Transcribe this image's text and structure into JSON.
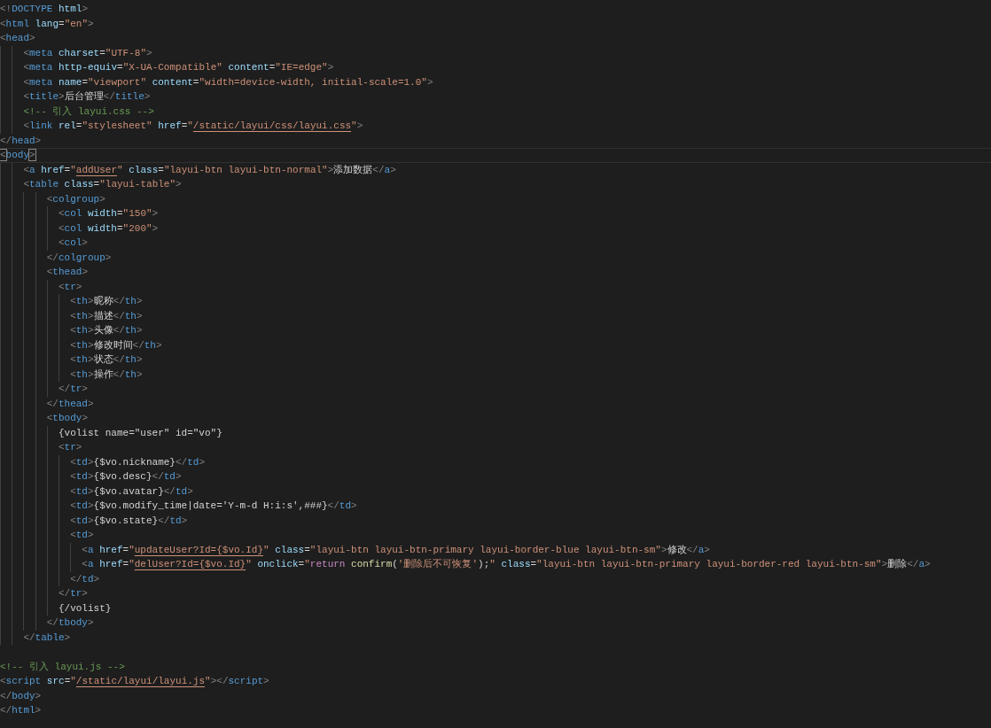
{
  "editor": {
    "lines": [
      {
        "current": false,
        "tokens": [
          {
            "kind": "punct",
            "text": "<!"
          },
          {
            "kind": "tag",
            "text": "DOCTYPE"
          },
          {
            "kind": "attr",
            "text": " html"
          },
          {
            "kind": "punct",
            "text": ">"
          }
        ]
      },
      {
        "current": false,
        "tokens": [
          {
            "kind": "punct",
            "text": "<"
          },
          {
            "kind": "tag",
            "text": "html"
          },
          {
            "kind": "attr",
            "text": " lang"
          },
          {
            "kind": "text",
            "text": "="
          },
          {
            "kind": "string",
            "text": "\"en\""
          },
          {
            "kind": "punct",
            "text": ">"
          }
        ]
      },
      {
        "current": false,
        "tokens": [
          {
            "kind": "punct",
            "text": "<"
          },
          {
            "kind": "tag",
            "text": "head"
          },
          {
            "kind": "punct",
            "text": ">"
          }
        ],
        "children": [
          {
            "current": false,
            "tokens": [
              {
                "kind": "punct",
                "text": "<"
              },
              {
                "kind": "tag",
                "text": "meta"
              },
              {
                "kind": "attr",
                "text": " charset"
              },
              {
                "kind": "text",
                "text": "="
              },
              {
                "kind": "string",
                "text": "\"UTF-8\""
              },
              {
                "kind": "punct",
                "text": ">"
              }
            ]
          },
          {
            "current": false,
            "tokens": [
              {
                "kind": "punct",
                "text": "<"
              },
              {
                "kind": "tag",
                "text": "meta"
              },
              {
                "kind": "attr",
                "text": " http-equiv"
              },
              {
                "kind": "text",
                "text": "="
              },
              {
                "kind": "string",
                "text": "\"X-UA-Compatible\""
              },
              {
                "kind": "attr",
                "text": " content"
              },
              {
                "kind": "text",
                "text": "="
              },
              {
                "kind": "string",
                "text": "\"IE=edge\""
              },
              {
                "kind": "punct",
                "text": ">"
              }
            ]
          },
          {
            "current": false,
            "tokens": [
              {
                "kind": "punct",
                "text": "<"
              },
              {
                "kind": "tag",
                "text": "meta"
              },
              {
                "kind": "attr",
                "text": " name"
              },
              {
                "kind": "text",
                "text": "="
              },
              {
                "kind": "string",
                "text": "\"viewport\""
              },
              {
                "kind": "attr",
                "text": " content"
              },
              {
                "kind": "text",
                "text": "="
              },
              {
                "kind": "string",
                "text": "\"width=device-width, initial-scale=1.0\""
              },
              {
                "kind": "punct",
                "text": ">"
              }
            ]
          },
          {
            "current": false,
            "tokens": [
              {
                "kind": "punct",
                "text": "<"
              },
              {
                "kind": "tag",
                "text": "title"
              },
              {
                "kind": "punct",
                "text": ">"
              },
              {
                "kind": "text",
                "text": "后台管理"
              },
              {
                "kind": "punct",
                "text": "</"
              },
              {
                "kind": "tag",
                "text": "title"
              },
              {
                "kind": "punct",
                "text": ">"
              }
            ]
          },
          {
            "current": false,
            "tokens": [
              {
                "kind": "comment",
                "text": "<!-- 引入 layui.css -->"
              }
            ]
          },
          {
            "current": false,
            "tokens": [
              {
                "kind": "punct",
                "text": "<"
              },
              {
                "kind": "tag",
                "text": "link"
              },
              {
                "kind": "attr",
                "text": " rel"
              },
              {
                "kind": "text",
                "text": "="
              },
              {
                "kind": "string",
                "text": "\"stylesheet\""
              },
              {
                "kind": "attr",
                "text": " href"
              },
              {
                "kind": "text",
                "text": "="
              },
              {
                "kind": "string",
                "text": "\""
              },
              {
                "kind": "link",
                "text": "/static/layui/css/layui.css"
              },
              {
                "kind": "string",
                "text": "\""
              },
              {
                "kind": "punct",
                "text": ">"
              }
            ]
          }
        ]
      },
      {
        "current": false,
        "tokens": [
          {
            "kind": "punct",
            "text": "</"
          },
          {
            "kind": "tag",
            "text": "head"
          },
          {
            "kind": "punct",
            "text": ">"
          }
        ]
      },
      {
        "current": true,
        "tokens": [
          {
            "kind": "match",
            "text": "<"
          },
          {
            "kind": "tag",
            "text": "body"
          },
          {
            "kind": "match",
            "text": ">"
          }
        ],
        "children": [
          {
            "current": false,
            "tokens": [
              {
                "kind": "punct",
                "text": "<"
              },
              {
                "kind": "tag",
                "text": "a"
              },
              {
                "kind": "attr",
                "text": " href"
              },
              {
                "kind": "text",
                "text": "="
              },
              {
                "kind": "string",
                "text": "\""
              },
              {
                "kind": "link",
                "text": "addUser"
              },
              {
                "kind": "string",
                "text": "\""
              },
              {
                "kind": "attr",
                "text": " class"
              },
              {
                "kind": "text",
                "text": "="
              },
              {
                "kind": "string",
                "text": "\"layui-btn layui-btn-normal\""
              },
              {
                "kind": "punct",
                "text": ">"
              },
              {
                "kind": "text",
                "text": "添加数据"
              },
              {
                "kind": "punct",
                "text": "</"
              },
              {
                "kind": "tag",
                "text": "a"
              },
              {
                "kind": "punct",
                "text": ">"
              }
            ]
          },
          {
            "current": false,
            "tokens": [
              {
                "kind": "punct",
                "text": "<"
              },
              {
                "kind": "tag",
                "text": "table"
              },
              {
                "kind": "attr",
                "text": " class"
              },
              {
                "kind": "text",
                "text": "="
              },
              {
                "kind": "string",
                "text": "\"layui-table\""
              },
              {
                "kind": "punct",
                "text": ">"
              }
            ],
            "children": [
              {
                "current": false,
                "tokens": [
                  {
                    "kind": "punct",
                    "text": "<"
                  },
                  {
                    "kind": "tag",
                    "text": "colgroup"
                  },
                  {
                    "kind": "punct",
                    "text": ">"
                  }
                ],
                "children": [
                  {
                    "current": false,
                    "tokens": [
                      {
                        "kind": "punct",
                        "text": "<"
                      },
                      {
                        "kind": "tag",
                        "text": "col"
                      },
                      {
                        "kind": "attr",
                        "text": " width"
                      },
                      {
                        "kind": "text",
                        "text": "="
                      },
                      {
                        "kind": "string",
                        "text": "\"150\""
                      },
                      {
                        "kind": "punct",
                        "text": ">"
                      }
                    ]
                  },
                  {
                    "current": false,
                    "tokens": [
                      {
                        "kind": "punct",
                        "text": "<"
                      },
                      {
                        "kind": "tag",
                        "text": "col"
                      },
                      {
                        "kind": "attr",
                        "text": " width"
                      },
                      {
                        "kind": "text",
                        "text": "="
                      },
                      {
                        "kind": "string",
                        "text": "\"200\""
                      },
                      {
                        "kind": "punct",
                        "text": ">"
                      }
                    ]
                  },
                  {
                    "current": false,
                    "tokens": [
                      {
                        "kind": "punct",
                        "text": "<"
                      },
                      {
                        "kind": "tag",
                        "text": "col"
                      },
                      {
                        "kind": "punct",
                        "text": ">"
                      }
                    ]
                  }
                ]
              },
              {
                "current": false,
                "tokens": [
                  {
                    "kind": "punct",
                    "text": "</"
                  },
                  {
                    "kind": "tag",
                    "text": "colgroup"
                  },
                  {
                    "kind": "punct",
                    "text": ">"
                  }
                ]
              },
              {
                "current": false,
                "tokens": [
                  {
                    "kind": "punct",
                    "text": "<"
                  },
                  {
                    "kind": "tag",
                    "text": "thead"
                  },
                  {
                    "kind": "punct",
                    "text": ">"
                  }
                ],
                "children": [
                  {
                    "current": false,
                    "tokens": [
                      {
                        "kind": "punct",
                        "text": "<"
                      },
                      {
                        "kind": "tag",
                        "text": "tr"
                      },
                      {
                        "kind": "punct",
                        "text": ">"
                      }
                    ],
                    "children": [
                      {
                        "current": false,
                        "tokens": [
                          {
                            "kind": "punct",
                            "text": "<"
                          },
                          {
                            "kind": "tag",
                            "text": "th"
                          },
                          {
                            "kind": "punct",
                            "text": ">"
                          },
                          {
                            "kind": "text",
                            "text": "昵称"
                          },
                          {
                            "kind": "punct",
                            "text": "</"
                          },
                          {
                            "kind": "tag",
                            "text": "th"
                          },
                          {
                            "kind": "punct",
                            "text": ">"
                          }
                        ]
                      },
                      {
                        "current": false,
                        "tokens": [
                          {
                            "kind": "punct",
                            "text": "<"
                          },
                          {
                            "kind": "tag",
                            "text": "th"
                          },
                          {
                            "kind": "punct",
                            "text": ">"
                          },
                          {
                            "kind": "text",
                            "text": "描述"
                          },
                          {
                            "kind": "punct",
                            "text": "</"
                          },
                          {
                            "kind": "tag",
                            "text": "th"
                          },
                          {
                            "kind": "punct",
                            "text": ">"
                          }
                        ]
                      },
                      {
                        "current": false,
                        "tokens": [
                          {
                            "kind": "punct",
                            "text": "<"
                          },
                          {
                            "kind": "tag",
                            "text": "th"
                          },
                          {
                            "kind": "punct",
                            "text": ">"
                          },
                          {
                            "kind": "text",
                            "text": "头像"
                          },
                          {
                            "kind": "punct",
                            "text": "</"
                          },
                          {
                            "kind": "tag",
                            "text": "th"
                          },
                          {
                            "kind": "punct",
                            "text": ">"
                          }
                        ]
                      },
                      {
                        "current": false,
                        "tokens": [
                          {
                            "kind": "punct",
                            "text": "<"
                          },
                          {
                            "kind": "tag",
                            "text": "th"
                          },
                          {
                            "kind": "punct",
                            "text": ">"
                          },
                          {
                            "kind": "text",
                            "text": "修改时间"
                          },
                          {
                            "kind": "punct",
                            "text": "</"
                          },
                          {
                            "kind": "tag",
                            "text": "th"
                          },
                          {
                            "kind": "punct",
                            "text": ">"
                          }
                        ]
                      },
                      {
                        "current": false,
                        "tokens": [
                          {
                            "kind": "punct",
                            "text": "<"
                          },
                          {
                            "kind": "tag",
                            "text": "th"
                          },
                          {
                            "kind": "punct",
                            "text": ">"
                          },
                          {
                            "kind": "text",
                            "text": "状态"
                          },
                          {
                            "kind": "punct",
                            "text": "</"
                          },
                          {
                            "kind": "tag",
                            "text": "th"
                          },
                          {
                            "kind": "punct",
                            "text": ">"
                          }
                        ]
                      },
                      {
                        "current": false,
                        "tokens": [
                          {
                            "kind": "punct",
                            "text": "<"
                          },
                          {
                            "kind": "tag",
                            "text": "th"
                          },
                          {
                            "kind": "punct",
                            "text": ">"
                          },
                          {
                            "kind": "text",
                            "text": "操作"
                          },
                          {
                            "kind": "punct",
                            "text": "</"
                          },
                          {
                            "kind": "tag",
                            "text": "th"
                          },
                          {
                            "kind": "punct",
                            "text": ">"
                          }
                        ]
                      }
                    ]
                  },
                  {
                    "current": false,
                    "tokens": [
                      {
                        "kind": "punct",
                        "text": "</"
                      },
                      {
                        "kind": "tag",
                        "text": "tr"
                      },
                      {
                        "kind": "punct",
                        "text": ">"
                      }
                    ]
                  }
                ]
              },
              {
                "current": false,
                "tokens": [
                  {
                    "kind": "punct",
                    "text": "</"
                  },
                  {
                    "kind": "tag",
                    "text": "thead"
                  },
                  {
                    "kind": "punct",
                    "text": ">"
                  }
                ]
              },
              {
                "current": false,
                "tokens": [
                  {
                    "kind": "punct",
                    "text": "<"
                  },
                  {
                    "kind": "tag",
                    "text": "tbody"
                  },
                  {
                    "kind": "punct",
                    "text": ">"
                  }
                ],
                "children": [
                  {
                    "current": false,
                    "tokens": [
                      {
                        "kind": "text",
                        "text": "{volist name=\"user\" id=\"vo\"}"
                      }
                    ]
                  },
                  {
                    "current": false,
                    "tokens": [
                      {
                        "kind": "punct",
                        "text": "<"
                      },
                      {
                        "kind": "tag",
                        "text": "tr"
                      },
                      {
                        "kind": "punct",
                        "text": ">"
                      }
                    ],
                    "children": [
                      {
                        "current": false,
                        "tokens": [
                          {
                            "kind": "punct",
                            "text": "<"
                          },
                          {
                            "kind": "tag",
                            "text": "td"
                          },
                          {
                            "kind": "punct",
                            "text": ">"
                          },
                          {
                            "kind": "text",
                            "text": "{$vo.nickname}"
                          },
                          {
                            "kind": "punct",
                            "text": "</"
                          },
                          {
                            "kind": "tag",
                            "text": "td"
                          },
                          {
                            "kind": "punct",
                            "text": ">"
                          }
                        ]
                      },
                      {
                        "current": false,
                        "tokens": [
                          {
                            "kind": "punct",
                            "text": "<"
                          },
                          {
                            "kind": "tag",
                            "text": "td"
                          },
                          {
                            "kind": "punct",
                            "text": ">"
                          },
                          {
                            "kind": "text",
                            "text": "{$vo.desc}"
                          },
                          {
                            "kind": "punct",
                            "text": "</"
                          },
                          {
                            "kind": "tag",
                            "text": "td"
                          },
                          {
                            "kind": "punct",
                            "text": ">"
                          }
                        ]
                      },
                      {
                        "current": false,
                        "tokens": [
                          {
                            "kind": "punct",
                            "text": "<"
                          },
                          {
                            "kind": "tag",
                            "text": "td"
                          },
                          {
                            "kind": "punct",
                            "text": ">"
                          },
                          {
                            "kind": "text",
                            "text": "{$vo.avatar}"
                          },
                          {
                            "kind": "punct",
                            "text": "</"
                          },
                          {
                            "kind": "tag",
                            "text": "td"
                          },
                          {
                            "kind": "punct",
                            "text": ">"
                          }
                        ]
                      },
                      {
                        "current": false,
                        "tokens": [
                          {
                            "kind": "punct",
                            "text": "<"
                          },
                          {
                            "kind": "tag",
                            "text": "td"
                          },
                          {
                            "kind": "punct",
                            "text": ">"
                          },
                          {
                            "kind": "text",
                            "text": "{$vo.modify_time|date='Y-m-d H:i:s',###}"
                          },
                          {
                            "kind": "punct",
                            "text": "</"
                          },
                          {
                            "kind": "tag",
                            "text": "td"
                          },
                          {
                            "kind": "punct",
                            "text": ">"
                          }
                        ]
                      },
                      {
                        "current": false,
                        "tokens": [
                          {
                            "kind": "punct",
                            "text": "<"
                          },
                          {
                            "kind": "tag",
                            "text": "td"
                          },
                          {
                            "kind": "punct",
                            "text": ">"
                          },
                          {
                            "kind": "text",
                            "text": "{$vo.state}"
                          },
                          {
                            "kind": "punct",
                            "text": "</"
                          },
                          {
                            "kind": "tag",
                            "text": "td"
                          },
                          {
                            "kind": "punct",
                            "text": ">"
                          }
                        ]
                      },
                      {
                        "current": false,
                        "tokens": [
                          {
                            "kind": "punct",
                            "text": "<"
                          },
                          {
                            "kind": "tag",
                            "text": "td"
                          },
                          {
                            "kind": "punct",
                            "text": ">"
                          }
                        ],
                        "children": [
                          {
                            "current": false,
                            "tokens": [
                              {
                                "kind": "punct",
                                "text": "<"
                              },
                              {
                                "kind": "tag",
                                "text": "a"
                              },
                              {
                                "kind": "attr",
                                "text": " href"
                              },
                              {
                                "kind": "text",
                                "text": "="
                              },
                              {
                                "kind": "string",
                                "text": "\""
                              },
                              {
                                "kind": "link",
                                "text": "updateUser?Id={$vo.Id}"
                              },
                              {
                                "kind": "string",
                                "text": "\""
                              },
                              {
                                "kind": "attr",
                                "text": " class"
                              },
                              {
                                "kind": "text",
                                "text": "="
                              },
                              {
                                "kind": "string",
                                "text": "\"layui-btn layui-btn-primary layui-border-blue layui-btn-sm\""
                              },
                              {
                                "kind": "punct",
                                "text": ">"
                              },
                              {
                                "kind": "text",
                                "text": "修改"
                              },
                              {
                                "kind": "punct",
                                "text": "</"
                              },
                              {
                                "kind": "tag",
                                "text": "a"
                              },
                              {
                                "kind": "punct",
                                "text": ">"
                              }
                            ]
                          },
                          {
                            "current": false,
                            "tokens": [
                              {
                                "kind": "punct",
                                "text": "<"
                              },
                              {
                                "kind": "tag",
                                "text": "a"
                              },
                              {
                                "kind": "attr",
                                "text": " href"
                              },
                              {
                                "kind": "text",
                                "text": "="
                              },
                              {
                                "kind": "string",
                                "text": "\""
                              },
                              {
                                "kind": "link",
                                "text": "delUser?Id={$vo.Id}"
                              },
                              {
                                "kind": "string",
                                "text": "\""
                              },
                              {
                                "kind": "attr",
                                "text": " onclick"
                              },
                              {
                                "kind": "text",
                                "text": "="
                              },
                              {
                                "kind": "string",
                                "text": "\""
                              },
                              {
                                "kind": "keyword",
                                "text": "return"
                              },
                              {
                                "kind": "function",
                                "text": " confirm"
                              },
                              {
                                "kind": "text",
                                "text": "("
                              },
                              {
                                "kind": "string",
                                "text": "'删除后不可恢复'"
                              },
                              {
                                "kind": "text",
                                "text": ");"
                              },
                              {
                                "kind": "string",
                                "text": "\""
                              },
                              {
                                "kind": "attr",
                                "text": " class"
                              },
                              {
                                "kind": "text",
                                "text": "="
                              },
                              {
                                "kind": "string",
                                "text": "\"layui-btn layui-btn-primary layui-border-red layui-btn-sm\""
                              },
                              {
                                "kind": "punct",
                                "text": ">"
                              },
                              {
                                "kind": "text",
                                "text": "删除"
                              },
                              {
                                "kind": "punct",
                                "text": "</"
                              },
                              {
                                "kind": "tag",
                                "text": "a"
                              },
                              {
                                "kind": "punct",
                                "text": ">"
                              }
                            ]
                          }
                        ]
                      },
                      {
                        "current": false,
                        "tokens": [
                          {
                            "kind": "punct",
                            "text": "</"
                          },
                          {
                            "kind": "tag",
                            "text": "td"
                          },
                          {
                            "kind": "punct",
                            "text": ">"
                          }
                        ]
                      }
                    ]
                  },
                  {
                    "current": false,
                    "tokens": [
                      {
                        "kind": "punct",
                        "text": "</"
                      },
                      {
                        "kind": "tag",
                        "text": "tr"
                      },
                      {
                        "kind": "punct",
                        "text": ">"
                      }
                    ]
                  },
                  {
                    "current": false,
                    "tokens": [
                      {
                        "kind": "text",
                        "text": "{/volist}"
                      }
                    ]
                  }
                ]
              },
              {
                "current": false,
                "tokens": [
                  {
                    "kind": "punct",
                    "text": "</"
                  },
                  {
                    "kind": "tag",
                    "text": "tbody"
                  },
                  {
                    "kind": "punct",
                    "text": ">"
                  }
                ]
              }
            ]
          },
          {
            "current": false,
            "tokens": [
              {
                "kind": "punct",
                "text": "</"
              },
              {
                "kind": "tag",
                "text": "table"
              },
              {
                "kind": "punct",
                "text": ">"
              }
            ]
          }
        ]
      },
      {
        "current": false
      },
      {
        "current": false,
        "tokens": [
          {
            "kind": "comment",
            "text": "<!-- 引入 layui.js -->"
          }
        ]
      },
      {
        "current": false,
        "tokens": [
          {
            "kind": "punct",
            "text": "<"
          },
          {
            "kind": "tag",
            "text": "script"
          },
          {
            "kind": "attr",
            "text": " src"
          },
          {
            "kind": "text",
            "text": "="
          },
          {
            "kind": "string",
            "text": "\""
          },
          {
            "kind": "link",
            "text": "/static/layui/layui.js"
          },
          {
            "kind": "string",
            "text": "\""
          },
          {
            "kind": "punct",
            "text": "></"
          },
          {
            "kind": "tag",
            "text": "script"
          },
          {
            "kind": "punct",
            "text": ">"
          }
        ]
      },
      {
        "current": false,
        "tokens": [
          {
            "kind": "punct",
            "text": "</"
          },
          {
            "kind": "tag",
            "text": "body"
          },
          {
            "kind": "punct",
            "text": ">"
          }
        ]
      },
      {
        "current": false,
        "tokens": [
          {
            "kind": "punct",
            "text": "</"
          },
          {
            "kind": "tag",
            "text": "html"
          },
          {
            "kind": "punct",
            "text": ">"
          }
        ]
      }
    ]
  }
}
